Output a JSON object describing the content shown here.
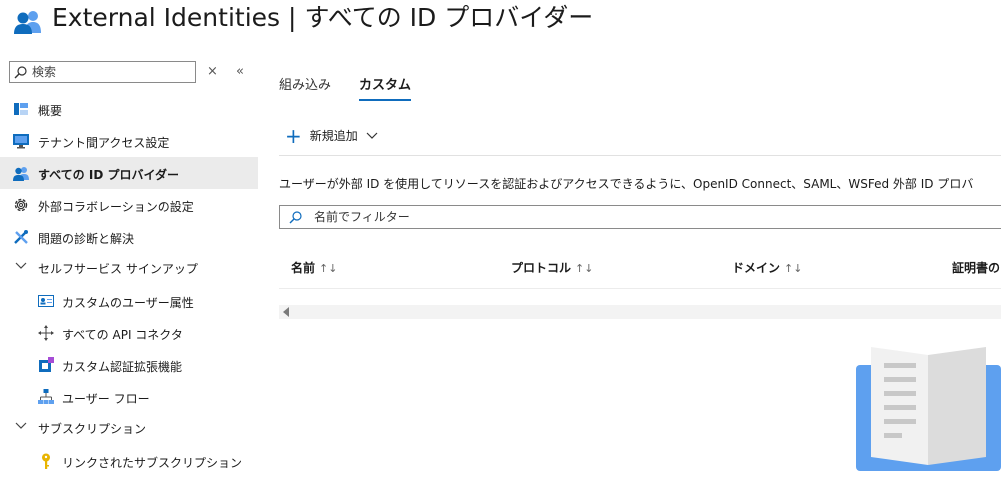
{
  "header": {
    "app_name": "External Identities",
    "separator": "|",
    "page_title": "すべての ID プロバイダー",
    "more": "…"
  },
  "sidebar": {
    "search_placeholder": "検索",
    "clear": "×",
    "collapse": "«",
    "items": [
      {
        "label": "概要",
        "icon": "overview-icon"
      },
      {
        "label": "テナント間アクセス設定",
        "icon": "monitor-icon"
      },
      {
        "label": "すべての ID プロバイダー",
        "icon": "users-icon",
        "active": true
      },
      {
        "label": "外部コラボレーションの設定",
        "icon": "gear-icon"
      },
      {
        "label": "問題の診断と解決",
        "icon": "wrench-icon"
      },
      {
        "label": "セルフサービス サインアップ",
        "group": true
      },
      {
        "label": "カスタムのユーザー属性",
        "icon": "user-card-icon"
      },
      {
        "label": "すべての API コネクタ",
        "icon": "connector-icon"
      },
      {
        "label": "カスタム認証拡張機能",
        "icon": "extension-icon"
      },
      {
        "label": "ユーザー フロー",
        "icon": "flow-icon"
      },
      {
        "label": "サブスクリプション",
        "group": true
      },
      {
        "label": "リンクされたサブスクリプション",
        "icon": "key-icon"
      }
    ]
  },
  "main": {
    "tabs": [
      {
        "label": "組み込み"
      },
      {
        "label": "カスタム",
        "selected": true
      }
    ],
    "new_button": "新規追加",
    "description": "ユーザーが外部 ID を使用してリソースを認証およびアクセスできるように、OpenID Connect、SAML、WSFed 外部 ID プロバ",
    "filter_placeholder": "名前でフィルター",
    "columns": [
      "名前",
      "プロトコル",
      "ドメイン",
      "証明書の"
    ],
    "sort_glyph": "↑↓"
  },
  "colors": {
    "accent": "#0f6cbd",
    "active_bg": "#ebebeb"
  }
}
